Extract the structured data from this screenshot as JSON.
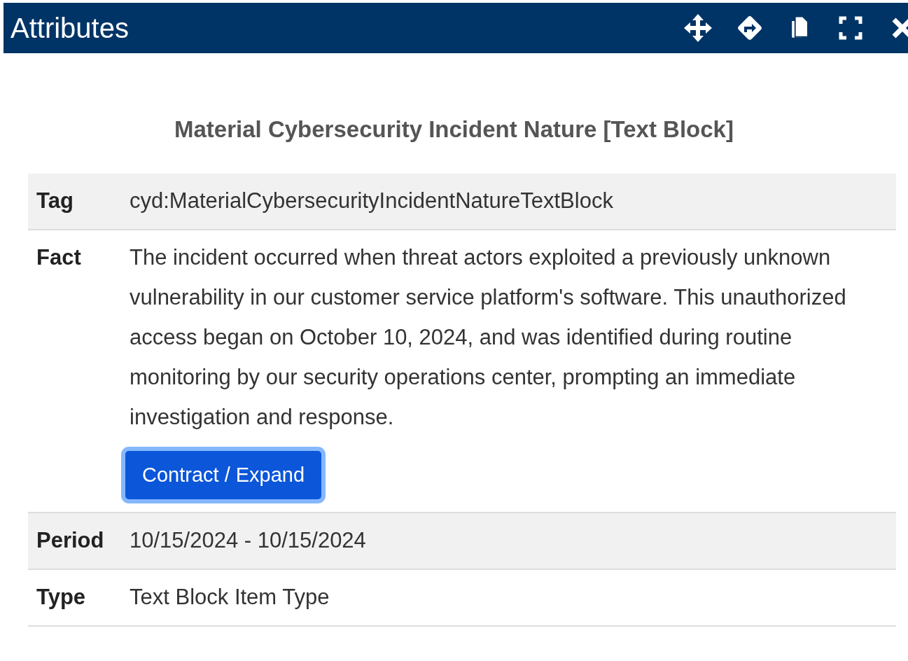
{
  "window": {
    "title": "Attributes"
  },
  "heading": "Material Cybersecurity Incident Nature [Text Block]",
  "rows": [
    {
      "label": "Tag",
      "value": "cyd:MaterialCybersecurityIncidentNatureTextBlock"
    },
    {
      "label": "Fact",
      "value": "The incident occurred when threat actors exploited a previously unknown vulnerability in our customer service platform's software. This unauthorized access began on October 10, 2024, and was identified during routine monitoring by our security operations center, prompting an immediate investigation and response.",
      "action": "Contract / Expand"
    },
    {
      "label": "Period",
      "value": "10/15/2024 - 10/15/2024"
    },
    {
      "label": "Type",
      "value": "Text Block Item Type"
    }
  ]
}
